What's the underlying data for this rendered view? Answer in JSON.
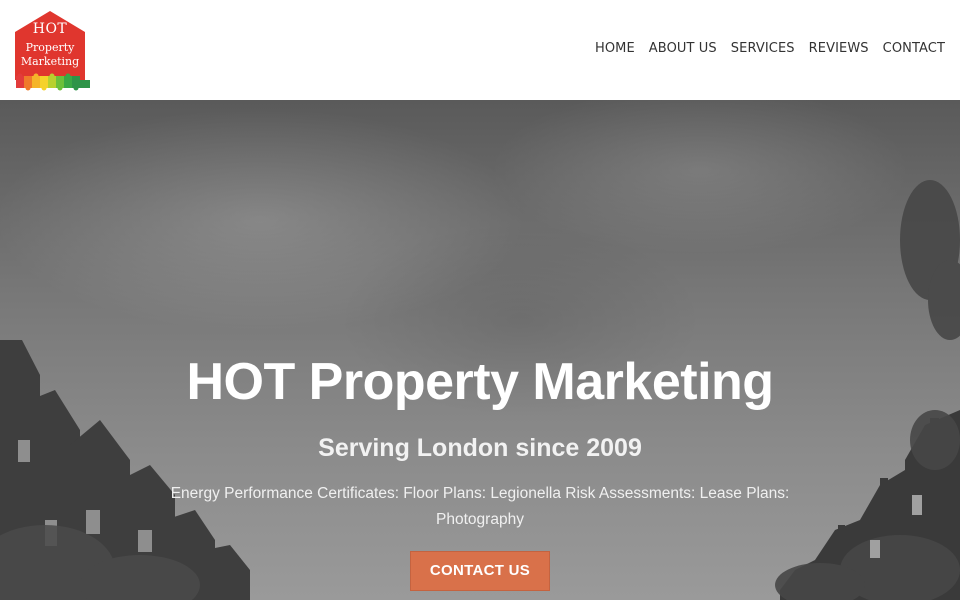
{
  "brand": {
    "logo_line1": "HOT",
    "logo_line2": "Property",
    "logo_line3": "Marketing",
    "logo_color": "#e0362e"
  },
  "nav": {
    "items": [
      {
        "label": "HOME"
      },
      {
        "label": "ABOUT US"
      },
      {
        "label": "SERVICES"
      },
      {
        "label": "REVIEWS"
      },
      {
        "label": "CONTACT"
      }
    ]
  },
  "hero": {
    "title": "HOT Property Marketing",
    "subtitle": "Serving London since 2009",
    "description": "Energy Performance Certificates: Floor Plans: Legionella Risk Assessments: Lease Plans: Photography",
    "cta_label": "CONTACT US",
    "cta_color": "#d9714a"
  }
}
